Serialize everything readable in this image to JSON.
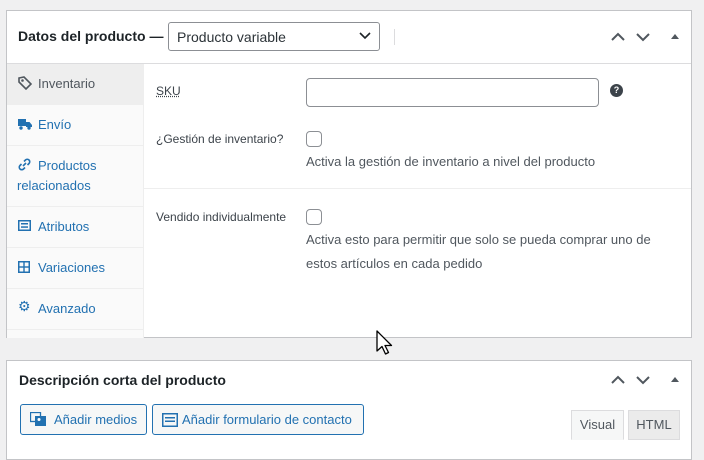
{
  "product_data": {
    "title": "Datos del producto —",
    "type_select": "Producto variable",
    "tabs": [
      {
        "label": "Inventario",
        "icon": "tag-icon"
      },
      {
        "label": "Envío",
        "icon": "truck-icon"
      },
      {
        "label": "Productos relacionados",
        "line1": "Productos",
        "line2": "relacionados",
        "icon": "link-icon"
      },
      {
        "label": "Atributos",
        "icon": "list-icon"
      },
      {
        "label": "Variaciones",
        "icon": "grid-icon"
      },
      {
        "label": "Avanzado",
        "icon": "gear-icon"
      }
    ],
    "sku_label": "SKU",
    "sku_value": "",
    "help_glyph": "?",
    "stock_label": "¿Gestión de inventario?",
    "stock_desc": "Activa la gestión de inventario a nivel del producto",
    "sold_label": "Vendido individualmente",
    "sold_desc_line1": "Activa esto para permitir que solo se pueda comprar uno de",
    "sold_desc_line2": "estos artículos en cada pedido"
  },
  "short_desc": {
    "title": "Descripción corta del producto",
    "add_media": "Añadir medios",
    "add_form": "Añadir formulario de contacto",
    "tab_visual": "Visual",
    "tab_html": "HTML"
  },
  "colors": {
    "link": "#2271b1",
    "border": "#c3c4c7",
    "text": "#1d2327"
  }
}
